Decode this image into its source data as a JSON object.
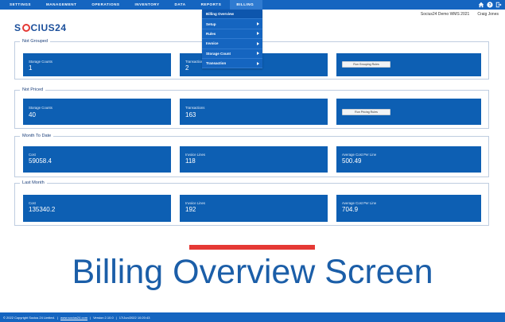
{
  "nav": {
    "items": [
      "SETTINGS",
      "MANAGEMENT",
      "OPERATIONS",
      "INVENTORY",
      "DATA",
      "REPORTS",
      "BILLING"
    ],
    "active": "BILLING"
  },
  "header": {
    "company": "Socius24 Demo WMS 2021",
    "user": "Craig Jones"
  },
  "logo": {
    "left": "S",
    "right": "CIUS24"
  },
  "billing_menu": {
    "items": [
      "Billing Overview",
      "Setup",
      "Rules",
      "Invoice",
      "Storage Count",
      "Transaction"
    ]
  },
  "panels": [
    {
      "title": "Not Grouped",
      "tiles": [
        {
          "label": "Storage Counts",
          "value": "1"
        },
        {
          "label": "Transactions",
          "value": "2"
        }
      ],
      "button": "Run Grouping Rules"
    },
    {
      "title": "Not Priced",
      "tiles": [
        {
          "label": "Storage Counts",
          "value": "40"
        },
        {
          "label": "Transactions",
          "value": "163"
        }
      ],
      "button": "Run Pricing Rules"
    },
    {
      "title": "Month To Date",
      "tiles": [
        {
          "label": "Cost",
          "value": "59058.4"
        },
        {
          "label": "Invoice Lines",
          "value": "118"
        },
        {
          "label": "Average Cost Per Line",
          "value": "500.49"
        }
      ]
    },
    {
      "title": "Last Month",
      "tiles": [
        {
          "label": "Cost",
          "value": "135340.2"
        },
        {
          "label": "Invoice Lines",
          "value": "192"
        },
        {
          "label": "Average Cost Per Line",
          "value": "704.9"
        }
      ]
    }
  ],
  "caption": "Billing Overview Screen",
  "footer": {
    "copyright": "© 2022 Copyright Socius 24 Limited.",
    "sep1": "|",
    "website": "www.socius24.com",
    "sep2": "|",
    "version": "Version 2.10.0",
    "sep3": "|",
    "datetime": "17/Jun/2022 10:20:43"
  },
  "colors": {
    "nav_blue": "#1565c0",
    "tile_blue": "#0d5fb3",
    "accent_red": "#e53935",
    "title_blue": "#1b5ea8"
  },
  "icons": [
    "home-icon",
    "help-icon",
    "logout-icon"
  ]
}
